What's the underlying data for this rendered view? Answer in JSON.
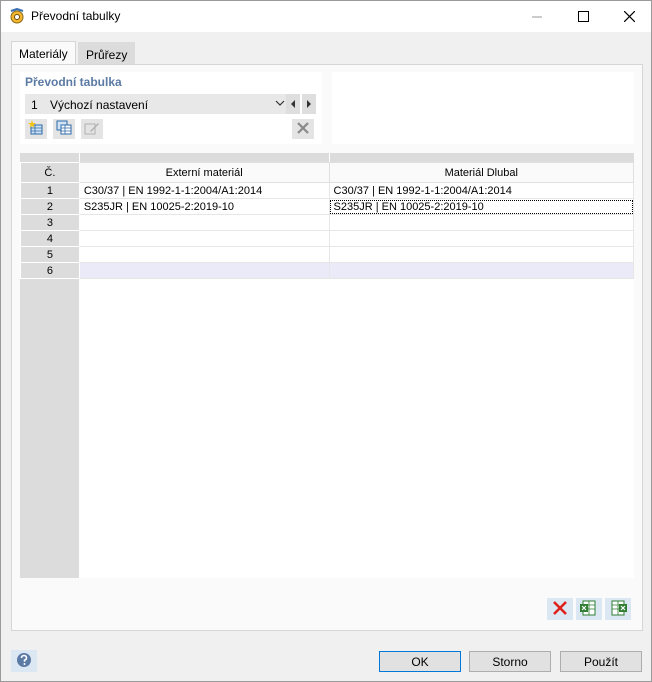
{
  "window": {
    "title": "Převodní tabulky"
  },
  "tabs": [
    {
      "label": "Materiály",
      "active": true
    },
    {
      "label": "Průřezy",
      "active": false
    }
  ],
  "conversion_table": {
    "group_title": "Převodní tabulka",
    "selected_number": "1",
    "selected_name": "Výchozí nastavení"
  },
  "grid": {
    "headers": [
      "Č.",
      "Externí materiál",
      "Materiál Dlubal"
    ],
    "rows": [
      {
        "num": "1",
        "external": "C30/37 | EN 1992-1-1:2004/A1:2014",
        "dlubal": "C30/37 | EN 1992-1-1:2004/A1:2014"
      },
      {
        "num": "2",
        "external": "S235JR | EN 10025-2:2019-10",
        "dlubal": "S235JR | EN 10025-2:2019-10"
      },
      {
        "num": "3",
        "external": "",
        "dlubal": ""
      },
      {
        "num": "4",
        "external": "",
        "dlubal": ""
      },
      {
        "num": "5",
        "external": "",
        "dlubal": ""
      },
      {
        "num": "6",
        "external": "",
        "dlubal": ""
      }
    ]
  },
  "buttons": {
    "ok": "OK",
    "cancel": "Storno",
    "apply": "Použít"
  },
  "colors": {
    "accent": "#0078d7",
    "group_title": "#5b7aa4",
    "selected_row": "#ebeaf8",
    "delete_red": "#e0201a"
  }
}
